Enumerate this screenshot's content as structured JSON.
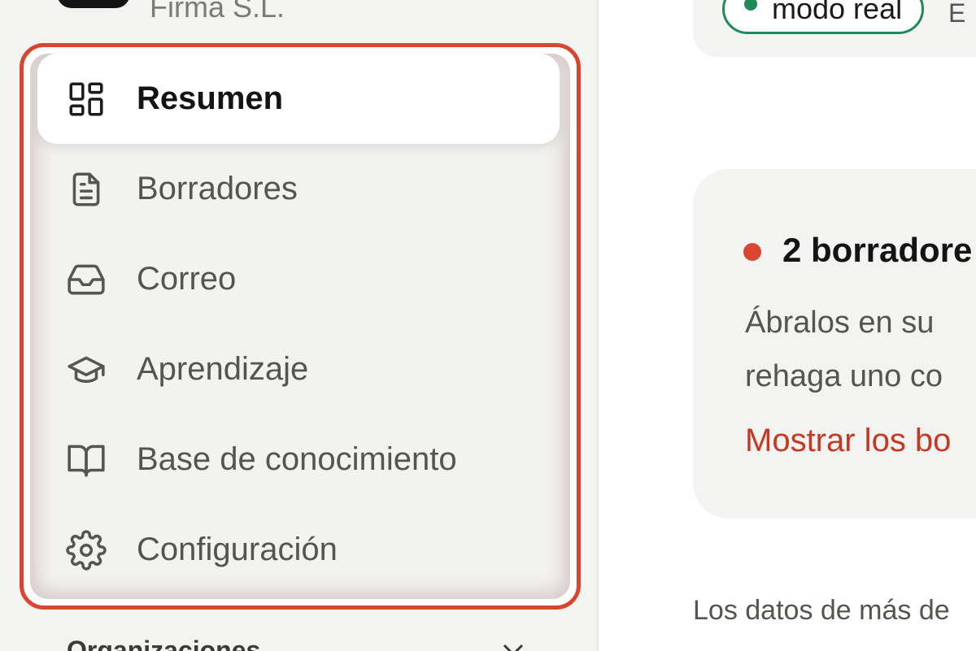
{
  "sidebar": {
    "org_name": "Firma S.L.",
    "items": [
      {
        "label": "Resumen",
        "icon": "dashboard-grid-icon",
        "active": true
      },
      {
        "label": "Borradores",
        "icon": "document-icon",
        "active": false
      },
      {
        "label": "Correo",
        "icon": "inbox-icon",
        "active": false
      },
      {
        "label": "Aprendizaje",
        "icon": "graduation-cap-icon",
        "active": false
      },
      {
        "label": "Base de conocimiento",
        "icon": "book-open-icon",
        "active": false
      },
      {
        "label": "Configuración",
        "icon": "gear-icon",
        "active": false
      }
    ],
    "section_label": "Organizaciones"
  },
  "main": {
    "mode_badge": "modo real",
    "top_extra": "E",
    "draft_card": {
      "title": "2 borradore",
      "body_line1": "Ábralos en su",
      "body_line2": "rehaga uno co",
      "link": "Mostrar los bo"
    },
    "footer_note": "Los datos de más de"
  },
  "colors": {
    "accent_red": "#d9452f",
    "link_red": "#c8371f",
    "status_green": "#1f8a57",
    "sidebar_bg": "#f3f3f1"
  }
}
